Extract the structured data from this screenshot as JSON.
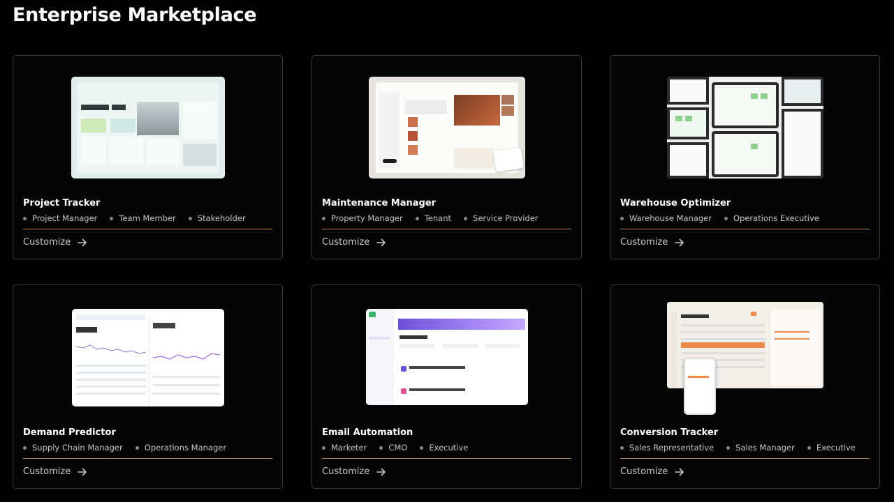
{
  "page": {
    "title": "Enterprise Marketplace"
  },
  "accent_color": "#b88a49",
  "cards": [
    {
      "title": "Project Tracker",
      "roles": [
        "Project Manager",
        "Team Member",
        "Stakeholder"
      ],
      "cta": "Customize",
      "cta_icon": "arrow-right-icon",
      "thumbnail": "project-tracker-preview"
    },
    {
      "title": "Maintenance Manager",
      "roles": [
        "Property Manager",
        "Tenant",
        "Service Provider"
      ],
      "cta": "Customize",
      "cta_icon": "arrow-right-icon",
      "thumbnail": "maintenance-manager-preview"
    },
    {
      "title": "Warehouse Optimizer",
      "roles": [
        "Warehouse Manager",
        "Operations Executive"
      ],
      "cta": "Customize",
      "cta_icon": "arrow-right-icon",
      "thumbnail": "warehouse-optimizer-preview"
    },
    {
      "title": "Demand Predictor",
      "roles": [
        "Supply Chain Manager",
        "Operations Manager"
      ],
      "cta": "Customize",
      "cta_icon": "arrow-right-icon",
      "thumbnail": "demand-predictor-preview"
    },
    {
      "title": "Email Automation",
      "roles": [
        "Marketer",
        "CMO",
        "Executive"
      ],
      "cta": "Customize",
      "cta_icon": "arrow-right-icon",
      "thumbnail": "email-automation-preview"
    },
    {
      "title": "Conversion Tracker",
      "roles": [
        "Sales Representative",
        "Sales Manager",
        "Executive"
      ],
      "cta": "Customize",
      "cta_icon": "arrow-right-icon",
      "thumbnail": "conversion-tracker-preview"
    }
  ]
}
